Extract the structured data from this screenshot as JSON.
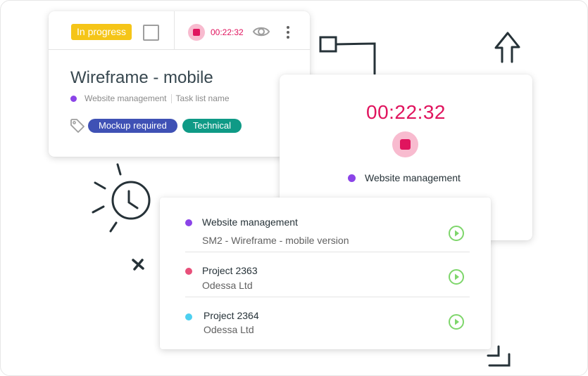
{
  "task": {
    "status": "In progress",
    "timer": "00:22:32",
    "title": "Wireframe - mobile",
    "project": "Website management",
    "task_list": "Task list name",
    "tags": [
      "Mockup required",
      "Technical"
    ]
  },
  "timer_panel": {
    "time": "00:22:32",
    "project": "Website management"
  },
  "recent": [
    {
      "title": "Website management",
      "subtitle": "SM2 - Wireframe - mobile version",
      "dot_color": "#8b44e8"
    },
    {
      "title": "Project 2363",
      "subtitle": "Odessa Ltd",
      "dot_color": "#e8507a"
    },
    {
      "title": "Project 2364",
      "subtitle": "Odessa Ltd",
      "dot_color": "#4dd0f0"
    }
  ],
  "colors": {
    "accent": "#e0145e",
    "status": "#f5c518",
    "play": "#7ed66b"
  },
  "icons": [
    "checkbox-icon",
    "stop-icon",
    "eye-icon",
    "more-vert-icon",
    "tag-icon",
    "play-icon"
  ]
}
